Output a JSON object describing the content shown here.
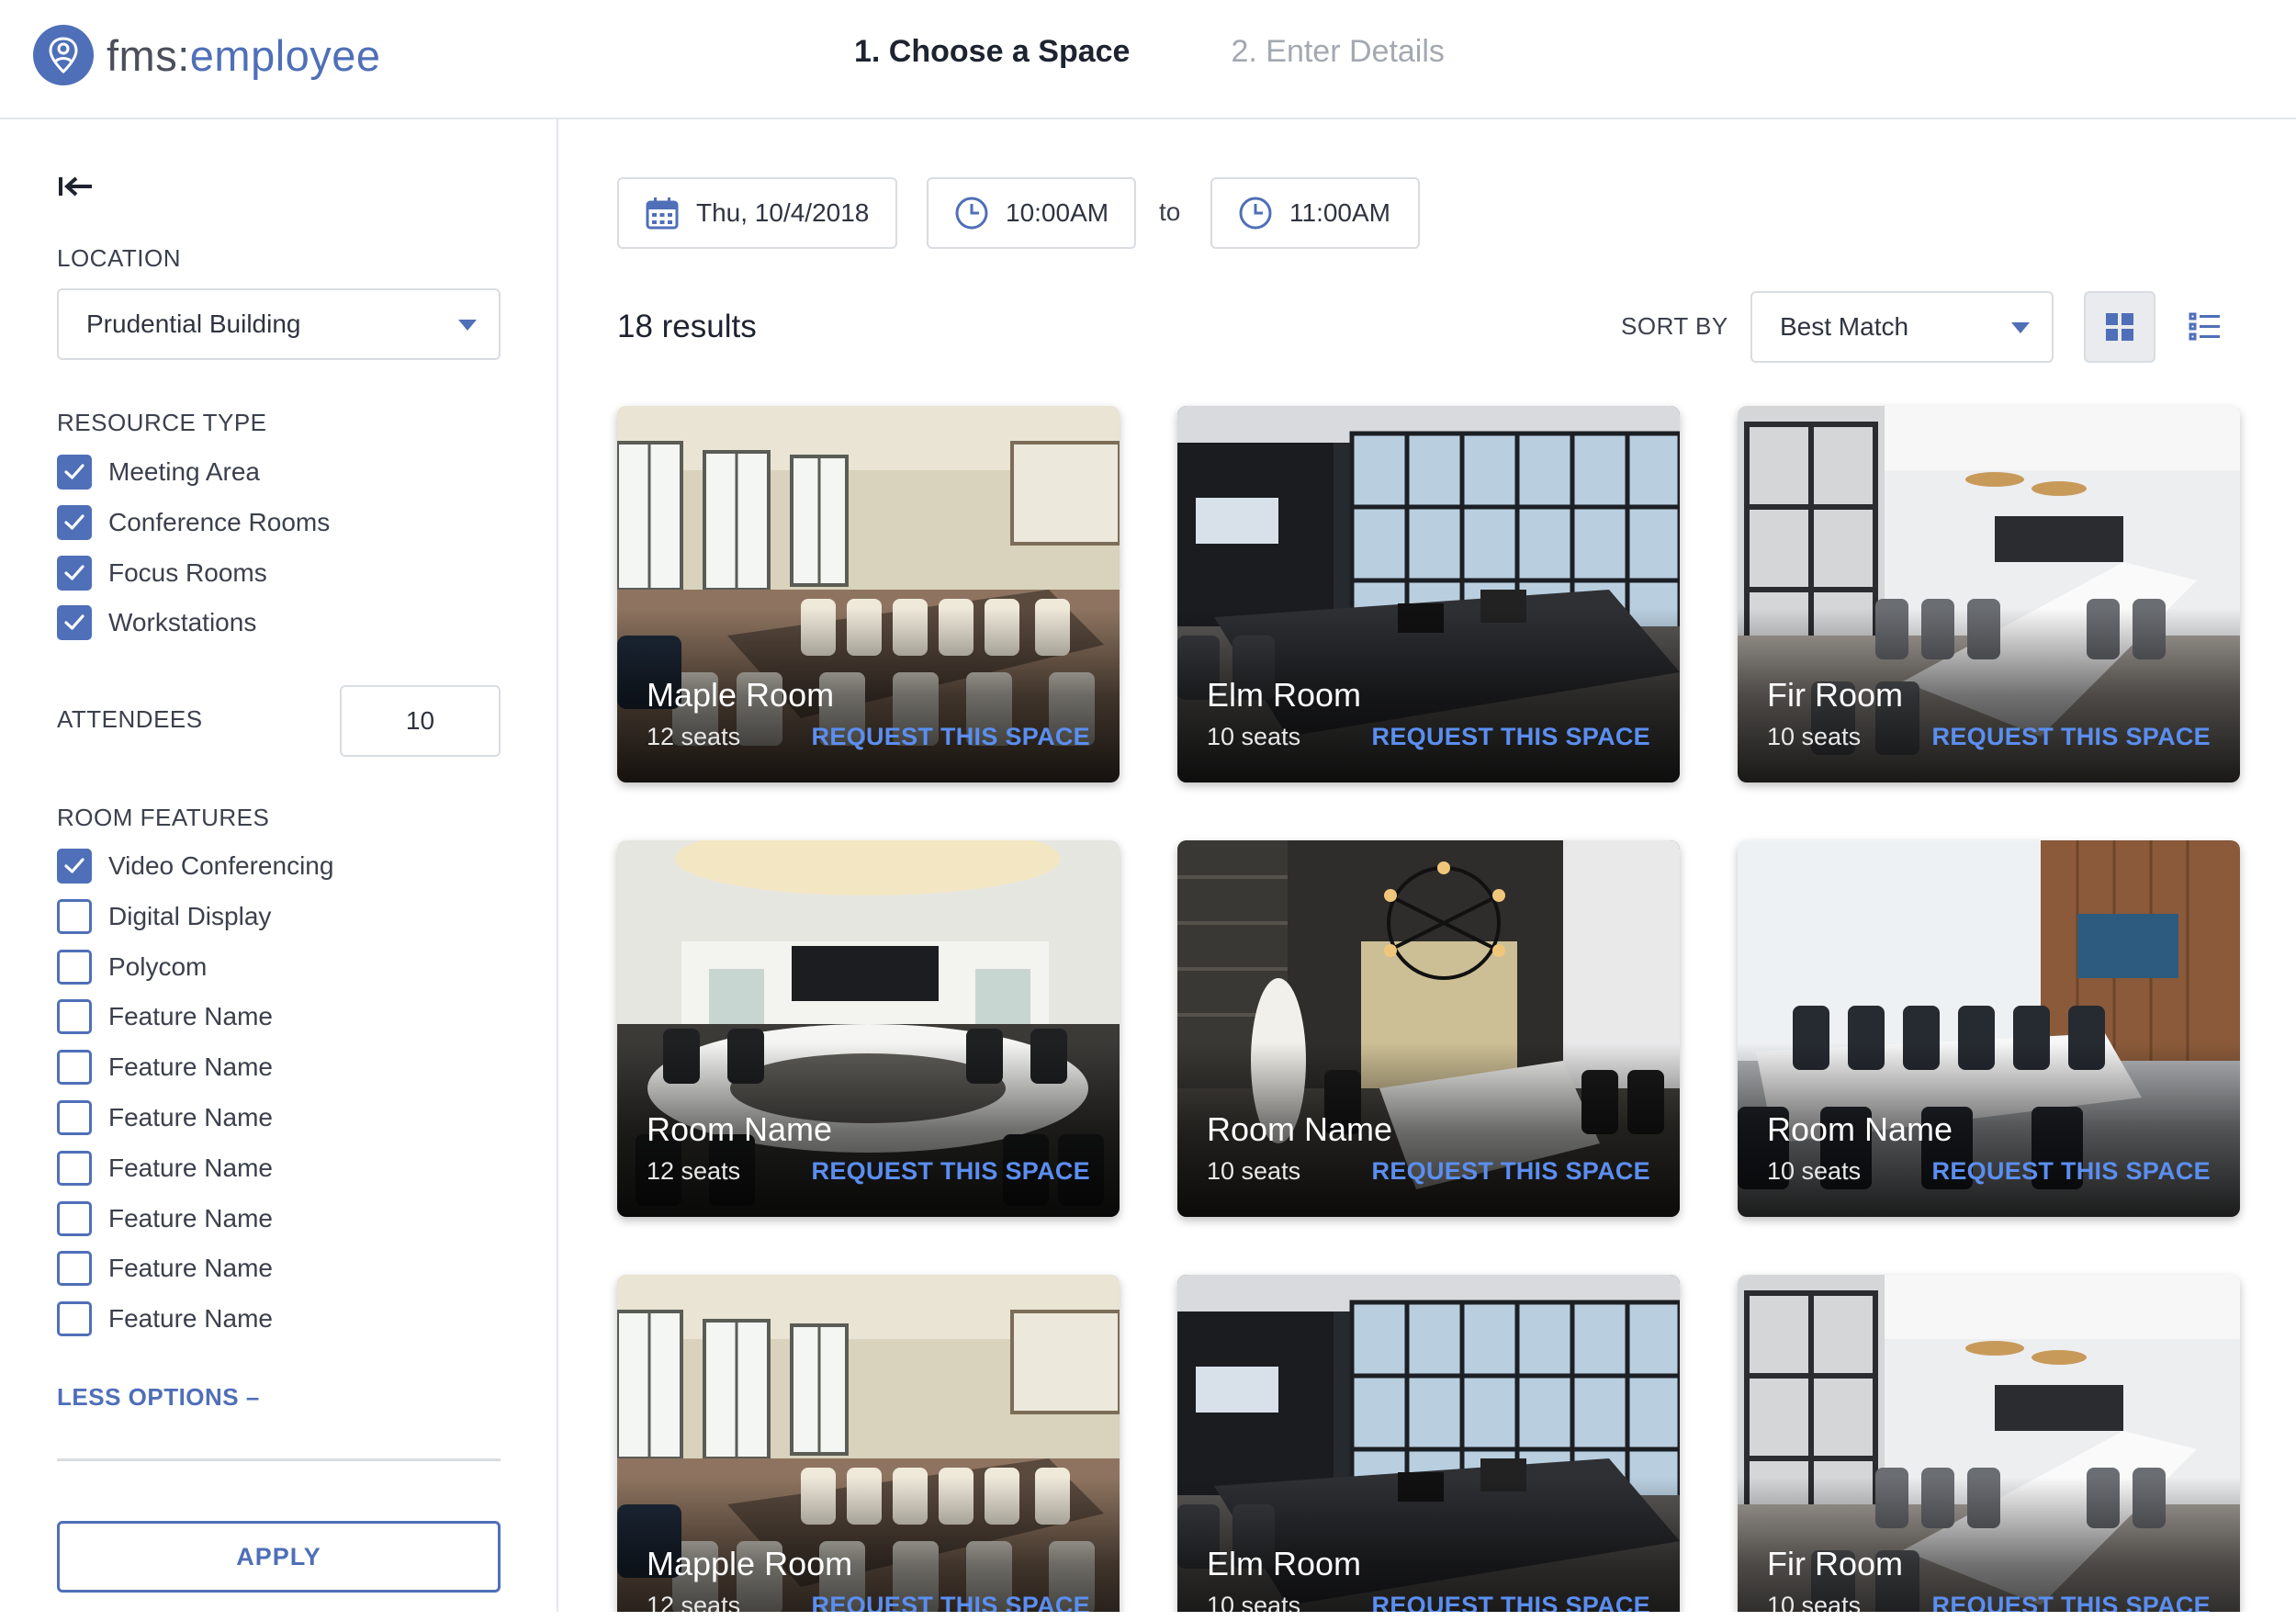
{
  "header": {
    "logo_prefix": "fms:",
    "logo_suffix": "employee",
    "steps": [
      {
        "label": "1. Choose a Space"
      },
      {
        "label": "2. Enter Details"
      }
    ]
  },
  "sidebar": {
    "location_label": "LOCATION",
    "location_value": "Prudential Building",
    "resource_type_label": "RESOURCE TYPE",
    "resource_types": [
      {
        "label": "Meeting Area",
        "checked": true
      },
      {
        "label": "Conference Rooms",
        "checked": true
      },
      {
        "label": "Focus Rooms",
        "checked": true
      },
      {
        "label": "Workstations",
        "checked": true
      }
    ],
    "attendees_label": "ATTENDEES",
    "attendees_value": "10",
    "room_features_label": "ROOM FEATURES",
    "room_features": [
      {
        "label": "Video Conferencing",
        "checked": true
      },
      {
        "label": "Digital Display",
        "checked": false
      },
      {
        "label": "Polycom",
        "checked": false
      },
      {
        "label": "Feature Name",
        "checked": false
      },
      {
        "label": "Feature Name",
        "checked": false
      },
      {
        "label": "Feature Name",
        "checked": false
      },
      {
        "label": "Feature Name",
        "checked": false
      },
      {
        "label": "Feature Name",
        "checked": false
      },
      {
        "label": "Feature Name",
        "checked": false
      },
      {
        "label": "Feature Name",
        "checked": false
      }
    ],
    "less_options": "LESS OPTIONS –",
    "apply_label": "APPLY"
  },
  "filters": {
    "date": "Thu, 10/4/2018",
    "start_time": "10:00AM",
    "to_label": "to",
    "end_time": "11:00AM"
  },
  "results": {
    "count_label": "18 results",
    "sort_label": "SORT BY",
    "sort_value": "Best Match"
  },
  "colors": {
    "accent": "#4f6fb8",
    "link": "#5b8ef0"
  },
  "request_label": "REQUEST THIS SPACE",
  "cards": [
    {
      "name": "Maple Room",
      "seats": "12 seats",
      "scene": "classic"
    },
    {
      "name": "Elm Room",
      "seats": "10 seats",
      "scene": "dark"
    },
    {
      "name": "Fir Room",
      "seats": "10 seats",
      "scene": "white"
    },
    {
      "name": "Room Name",
      "seats": "12 seats",
      "scene": "round"
    },
    {
      "name": "Room Name",
      "seats": "10 seats",
      "scene": "chandelier"
    },
    {
      "name": "Room Name",
      "seats": "10 seats",
      "scene": "wood"
    },
    {
      "name": "Mapple Room",
      "seats": "12 seats",
      "scene": "classic"
    },
    {
      "name": "Elm Room",
      "seats": "10 seats",
      "scene": "dark"
    },
    {
      "name": "Fir Room",
      "seats": "10 seats",
      "scene": "white"
    }
  ]
}
